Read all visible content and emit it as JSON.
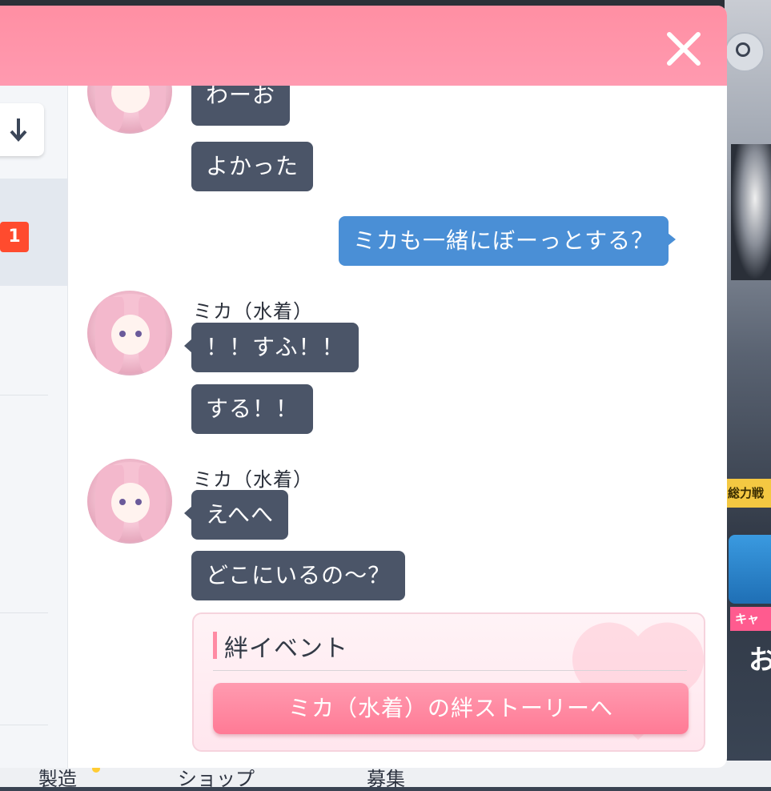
{
  "background": {
    "yellow_tag": "総力戦",
    "pink_tag": "キャ",
    "card_text": "お",
    "bottom_nav": [
      "製造",
      "ショップ",
      "募集"
    ]
  },
  "modal": {
    "close_icon": "close-icon",
    "sort_icon": "arrow-down-icon",
    "unread_count": "1"
  },
  "chat": {
    "messages": [
      {
        "sender": "",
        "text": "わーお"
      },
      {
        "sender": "",
        "text": "よかった"
      },
      {
        "sender": "me",
        "text": "ミカも一緒にぼーっとする？"
      },
      {
        "sender": "ミカ（水着）",
        "text": "！！すふ！！"
      },
      {
        "sender": "",
        "text": "する！！"
      },
      {
        "sender": "ミカ（水着）",
        "text": "えへへ"
      },
      {
        "sender": "",
        "text": "どこにいるの～？"
      }
    ],
    "names": [
      "ミカ（水着）",
      "ミカ（水着）"
    ]
  },
  "bond_event": {
    "title": "絆イベント",
    "button_label": "ミカ（水着）の絆ストーリーへ"
  },
  "colors": {
    "header_pink": "#ff8fa3",
    "bubble_dark": "#4b5568",
    "bubble_blue": "#4a8fd6",
    "badge_red": "#ff4b2e",
    "bond_button": "#ff7a95"
  }
}
